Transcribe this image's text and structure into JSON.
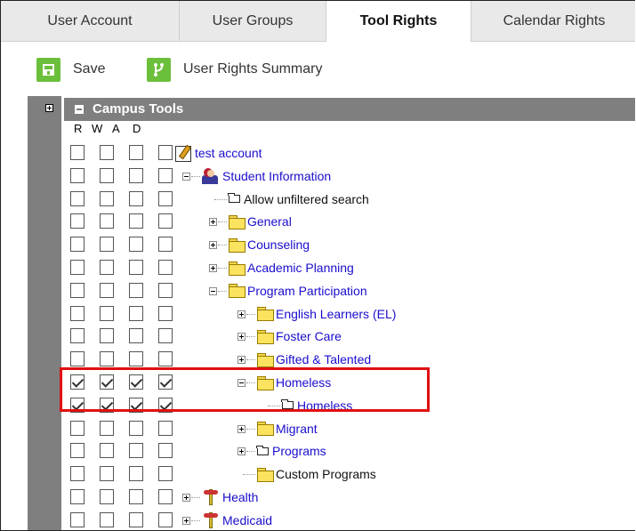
{
  "tabs": [
    {
      "label": "User Account",
      "active": false
    },
    {
      "label": "User Groups",
      "active": false
    },
    {
      "label": "Tool Rights",
      "active": true
    },
    {
      "label": "Calendar Rights",
      "active": false
    }
  ],
  "toolbar": {
    "save_label": "Save",
    "summary_label": "User Rights Summary"
  },
  "section": {
    "title": "Campus Tools",
    "columns": [
      "R",
      "W",
      "A",
      "D"
    ]
  },
  "tree": [
    {
      "label": "test account",
      "icon": "note-icon",
      "checked": false
    },
    {
      "label": "Student Information",
      "icon": "user-icon",
      "checked": false,
      "expander": "minus"
    },
    {
      "label": "Allow unfiltered search",
      "icon": "page-icon",
      "checked": false
    },
    {
      "label": "General",
      "icon": "folder-icon",
      "checked": false,
      "expander": "plus"
    },
    {
      "label": "Counseling",
      "icon": "folder-icon",
      "checked": false,
      "expander": "plus"
    },
    {
      "label": "Academic Planning",
      "icon": "folder-icon",
      "checked": false,
      "expander": "plus"
    },
    {
      "label": "Program Participation",
      "icon": "folder-icon",
      "checked": false,
      "expander": "minus"
    },
    {
      "label": "English Learners (EL)",
      "icon": "folder-icon",
      "checked": false,
      "expander": "plus"
    },
    {
      "label": "Foster Care",
      "icon": "folder-icon",
      "checked": false,
      "expander": "plus"
    },
    {
      "label": "Gifted & Talented",
      "icon": "folder-icon",
      "checked": false,
      "expander": "plus"
    },
    {
      "label": "Homeless",
      "icon": "folder-icon",
      "checked": true,
      "expander": "minus"
    },
    {
      "label": "Homeless",
      "icon": "page-icon",
      "checked": true
    },
    {
      "label": "Migrant",
      "icon": "folder-icon",
      "checked": false,
      "expander": "plus"
    },
    {
      "label": "Programs",
      "icon": "page-icon",
      "checked": false,
      "expander": "plus"
    },
    {
      "label": "Custom Programs",
      "icon": "folder-icon",
      "checked": false
    },
    {
      "label": "Health",
      "icon": "health-icon",
      "checked": false,
      "expander": "plus"
    },
    {
      "label": "Medicaid",
      "icon": "health-icon",
      "checked": false,
      "expander": "plus"
    }
  ],
  "colors": {
    "accent": "#6cbf3b",
    "link": "#1a0dcc",
    "highlight": "#e01010",
    "header_bg": "#7f7f7f"
  }
}
